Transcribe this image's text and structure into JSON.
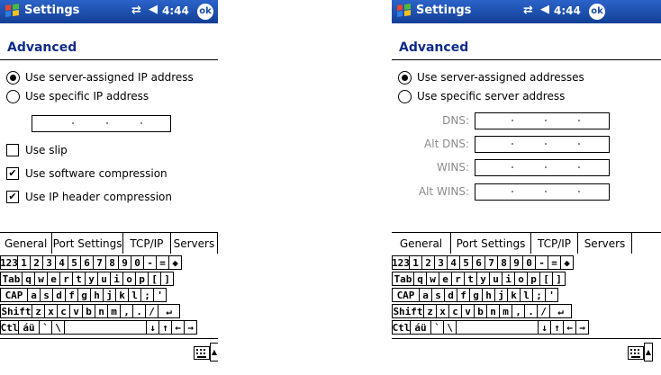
{
  "left": {
    "window": {
      "title": "Settings",
      "time": "4:44",
      "ok_label": "ok"
    },
    "section_title": "Advanced",
    "options": {
      "server_ip": "Use server-assigned IP address",
      "specific_ip": "Use specific IP address",
      "slip": "Use slip",
      "software_compression": "Use software compression",
      "ip_header_compression": "Use IP header compression"
    },
    "tabs": [
      "General",
      "Port Settings",
      "TCP/IP",
      "Servers"
    ]
  },
  "right": {
    "window": {
      "title": "Settings",
      "time": "4:44",
      "ok_label": "ok"
    },
    "section_title": "Advanced",
    "options": {
      "server_addresses": "Use server-assigned addresses",
      "specific_server": "Use specific server address"
    },
    "fields": {
      "dns": "DNS:",
      "alt_dns": "Alt DNS:",
      "wins": "WINS:",
      "alt_wins": "Alt WINS:"
    },
    "tabs": [
      "General",
      "Port Settings",
      "TCP/IP",
      "Servers"
    ]
  },
  "keyboard": {
    "row1": [
      "123",
      "1",
      "2",
      "3",
      "4",
      "5",
      "6",
      "7",
      "8",
      "9",
      "0",
      "-",
      "=",
      "◆"
    ],
    "row2": [
      "Tab",
      "q",
      "w",
      "e",
      "r",
      "t",
      "y",
      "u",
      "i",
      "o",
      "p",
      "[",
      "]"
    ],
    "row3": [
      "CAP",
      "a",
      "s",
      "d",
      "f",
      "g",
      "h",
      "j",
      "k",
      "l",
      ";",
      "'"
    ],
    "row4": [
      "Shift",
      "z",
      "x",
      "c",
      "v",
      "b",
      "n",
      "m",
      ",",
      ".",
      "/",
      "↵"
    ],
    "row5": [
      "Ctl",
      "áü",
      "`",
      "\\",
      "",
      "↓",
      "↑",
      "←",
      "→"
    ]
  }
}
